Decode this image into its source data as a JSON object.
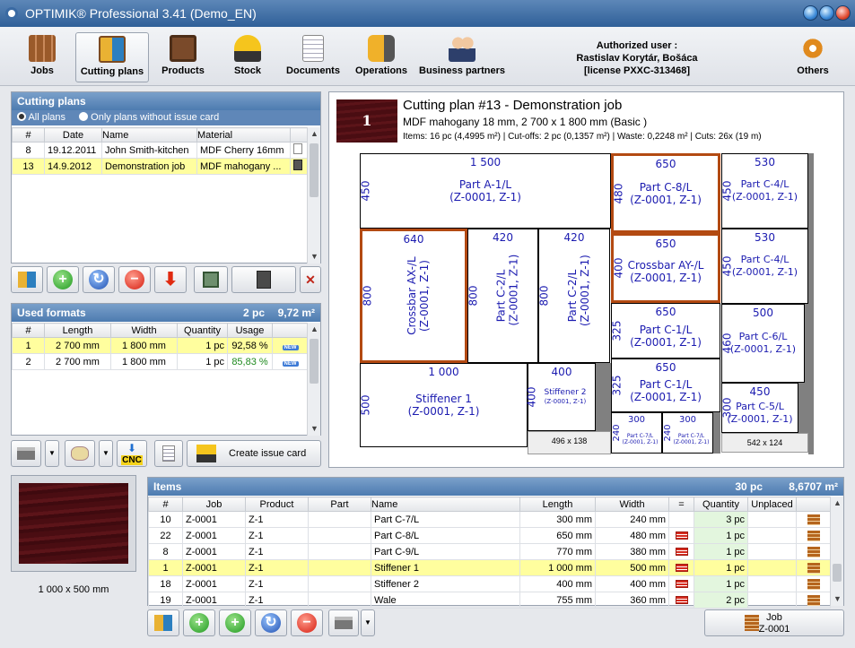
{
  "window": {
    "title": "OPTIMIK® Professional 3.41  (Demo_EN)"
  },
  "toolbar": {
    "items": [
      {
        "label": "Jobs",
        "icon": "jobs-icon"
      },
      {
        "label": "Cutting plans",
        "icon": "cutting-plans-icon"
      },
      {
        "label": "Products",
        "icon": "products-icon"
      },
      {
        "label": "Stock",
        "icon": "stock-forklift-icon"
      },
      {
        "label": "Documents",
        "icon": "documents-icon"
      },
      {
        "label": "Operations",
        "icon": "drill-icon"
      },
      {
        "label": "Business partners",
        "icon": "business-partners-icon"
      },
      {
        "label": "Others",
        "icon": "gears-icon"
      }
    ]
  },
  "auth": {
    "line1": "Authorized user :",
    "line2": "Rastislav Korytár, Bošáca",
    "line3": "[license PXXC-313468]"
  },
  "cutting_plans": {
    "title": "Cutting plans",
    "filter_all": "All plans",
    "filter_noissue": "Only plans without issue card",
    "columns": [
      "#",
      "Date",
      "Name",
      "Material"
    ],
    "rows": [
      {
        "num": "8",
        "date": "19.12.2011",
        "name": "John Smith-kitchen",
        "material": "MDF Cherry 16mm"
      },
      {
        "num": "13",
        "date": "14.9.2012",
        "name": "Demonstration job",
        "material": "MDF mahogany ..."
      }
    ]
  },
  "used_formats": {
    "title": "Used formats",
    "count": "2 pc",
    "area": "9,72 m²",
    "columns": [
      "#",
      "Length",
      "Width",
      "Quantity",
      "Usage"
    ],
    "rows": [
      {
        "num": "1",
        "length": "2 700 mm",
        "width": "1 800 mm",
        "qty": "1 pc",
        "usage": "92,58 %",
        "badge": "NEW"
      },
      {
        "num": "2",
        "length": "2 700 mm",
        "width": "1 800 mm",
        "qty": "1 pc",
        "usage": "85,83 %",
        "badge": "NEW"
      }
    ]
  },
  "actions": {
    "create_issue": "Create issue card",
    "cnc": "CNC"
  },
  "preview": {
    "caption": "1 000 x 500 mm"
  },
  "plan": {
    "number": "1",
    "title": "Cutting plan #13 - Demonstration job",
    "material": "MDF mahogany 18 mm, 2 700 x 1 800 mm (Basic  )",
    "stats": "Items: 16 pc  (4,4995 m²)  | Cut-offs: 2 pc  (0,1357 m²)  | Waste: 0,2248 m²  | Cuts: 26x  (19 m)",
    "pieces": [
      {
        "w": "1 500",
        "h": "450",
        "name": "Part A-1/L",
        "sub": "(Z-0001, Z-1)"
      },
      {
        "w": "650",
        "h": "480",
        "name": "Part C-8/L",
        "sub": "(Z-0001, Z-1)"
      },
      {
        "w": "530",
        "h": "450",
        "name": "Part C-4/L",
        "sub": "(Z-0001, Z-1)"
      },
      {
        "w": "640",
        "h": "800",
        "name": "Crossbar AX-/L",
        "sub": "(Z-0001, Z-1)"
      },
      {
        "w": "420",
        "h": "800",
        "name": "Part C-2/L",
        "sub": "(Z-0001, Z-1)"
      },
      {
        "w": "420",
        "h": "800",
        "name": "Part C-2/L",
        "sub": "(Z-0001, Z-1)"
      },
      {
        "w": "650",
        "h": "400",
        "name": "Crossbar AY-/L",
        "sub": "(Z-0001, Z-1)"
      },
      {
        "w": "530",
        "h": "450",
        "name": "Part C-4/L",
        "sub": "(Z-0001, Z-1)"
      },
      {
        "w": "650",
        "h": "325",
        "name": "Part C-1/L",
        "sub": "(Z-0001, Z-1)"
      },
      {
        "w": "500",
        "h": "460",
        "name": "Part C-6/L",
        "sub": "(Z-0001, Z-1)"
      },
      {
        "w": "650",
        "h": "325",
        "name": "Part C-1/L",
        "sub": "(Z-0001, Z-1)"
      },
      {
        "w": "1 000",
        "h": "500",
        "name": "Stiffener 1",
        "sub": "(Z-0001, Z-1)"
      },
      {
        "w": "400",
        "h": "400",
        "name": "Stiffener 2",
        "sub": "(Z-0001, Z-1)"
      },
      {
        "w": "450",
        "h": "300",
        "name": "Part C-5/L",
        "sub": "(Z-0001, Z-1)"
      },
      {
        "w": "300",
        "h": "240",
        "name": "Part C-7/L",
        "sub": "(Z-0001, Z-1)"
      },
      {
        "w": "300",
        "h": "240",
        "name": "Part C-7/L",
        "sub": "(Z-0001, Z-1)"
      }
    ],
    "offcuts": [
      "496 x 138",
      "542 x 124"
    ]
  },
  "items": {
    "title": "Items",
    "count": "30 pc",
    "area": "8,6707 m²",
    "columns": [
      "#",
      "Job",
      "Product",
      "Part",
      "Name",
      "Length",
      "Width",
      "=",
      "Quantity",
      "Unplaced"
    ],
    "rows": [
      {
        "num": "10",
        "job": "Z-0001",
        "product": "Z-1",
        "part": "",
        "name": "Part C-7/L",
        "length": "300 mm",
        "width": "240 mm",
        "eq": false,
        "qty": "3 pc"
      },
      {
        "num": "22",
        "job": "Z-0001",
        "product": "Z-1",
        "part": "",
        "name": "Part C-8/L",
        "length": "650 mm",
        "width": "480 mm",
        "eq": true,
        "qty": "1 pc"
      },
      {
        "num": "8",
        "job": "Z-0001",
        "product": "Z-1",
        "part": "",
        "name": "Part C-9/L",
        "length": "770 mm",
        "width": "380 mm",
        "eq": true,
        "qty": "1 pc"
      },
      {
        "num": "1",
        "job": "Z-0001",
        "product": "Z-1",
        "part": "",
        "name": "Stiffener 1",
        "length": "1 000 mm",
        "width": "500 mm",
        "eq": true,
        "qty": "1 pc"
      },
      {
        "num": "18",
        "job": "Z-0001",
        "product": "Z-1",
        "part": "",
        "name": "Stiffener 2",
        "length": "400 mm",
        "width": "400 mm",
        "eq": true,
        "qty": "1 pc"
      },
      {
        "num": "19",
        "job": "Z-0001",
        "product": "Z-1",
        "part": "",
        "name": "Wale",
        "length": "755 mm",
        "width": "360 mm",
        "eq": true,
        "qty": "2 pc"
      }
    ]
  },
  "job_button": {
    "label": "Job",
    "value": "Z-0001"
  }
}
